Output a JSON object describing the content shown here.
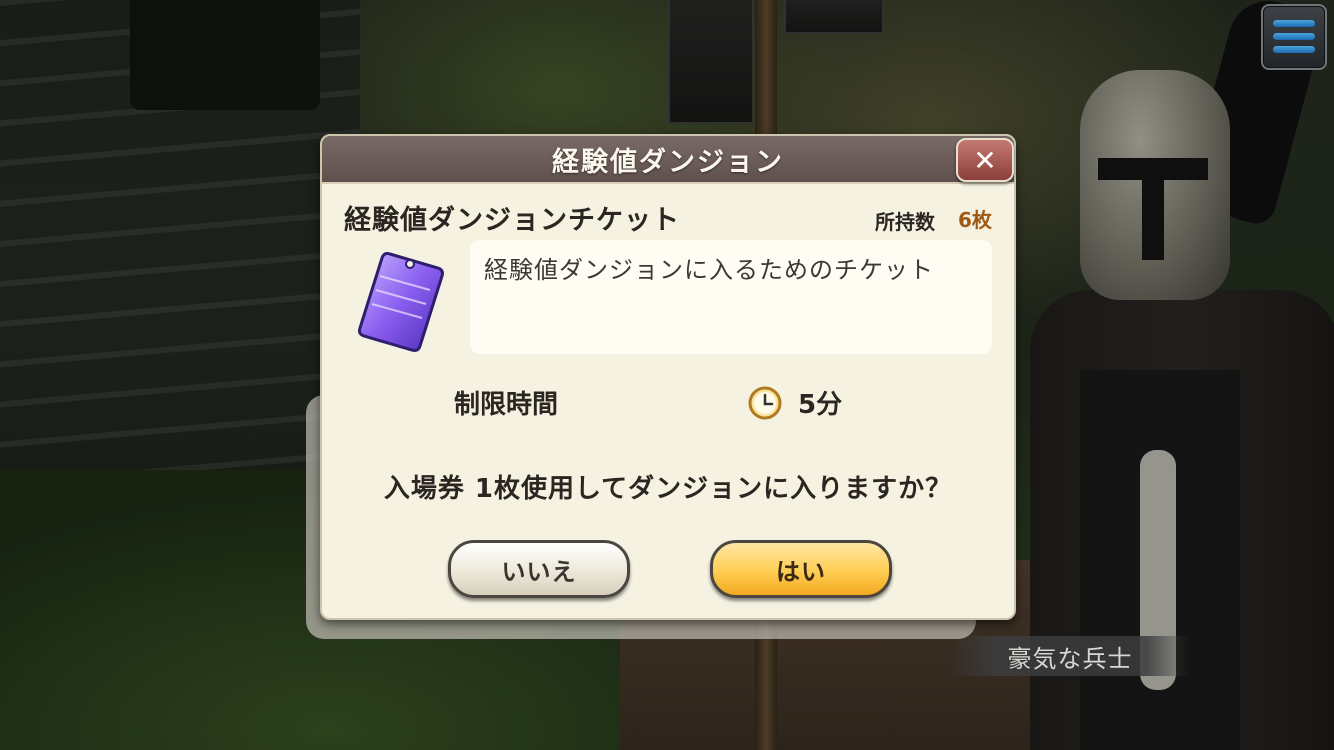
{
  "dialog": {
    "title": "経験値ダンジョン",
    "close_symbol": "✕",
    "item_name": "経験値ダンジョンチケット",
    "owned_label": "所持数",
    "owned_count": "6枚",
    "description": "経験値ダンジョンに入るためのチケット",
    "time_limit_label": "制限時間",
    "time_limit_value": "5分",
    "confirm_message": "入場券 1枚使用してダンジョンに入りますか？",
    "no_button": "いいえ",
    "yes_button": "はい"
  },
  "speaker": {
    "name": "豪気な兵士"
  },
  "icons": {
    "menu": "hamburger-menu-icon",
    "close": "close-icon",
    "ticket": "ticket-icon",
    "clock": "clock-icon"
  },
  "colors": {
    "header": "#6b5b58",
    "panel": "#f6f2e2",
    "yes_button": "#ffcd52",
    "count_accent": "#9c5a14"
  }
}
